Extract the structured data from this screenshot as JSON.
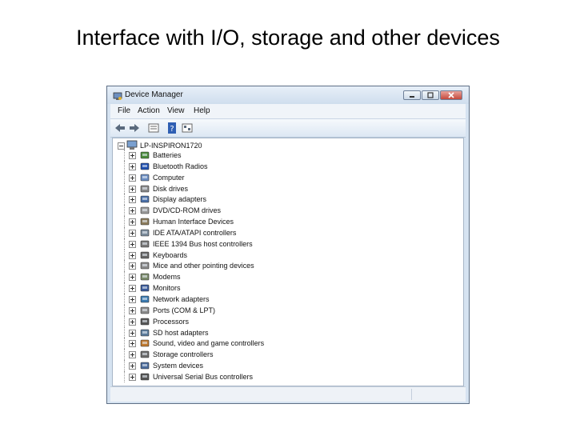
{
  "slide": {
    "title": "Interface with I/O, storage and other devices"
  },
  "window": {
    "title": "Device Manager",
    "controls": {
      "minimize": "",
      "maximize": "",
      "close": ""
    },
    "menu": [
      "File",
      "Action",
      "View",
      "Help"
    ],
    "toolbar": [
      "back-icon",
      "forward-icon",
      "properties-icon",
      "help-icon",
      "scan-icon"
    ],
    "tree": {
      "root": "LP-INSPIRON1720",
      "items": [
        {
          "label": "Batteries",
          "icon": "battery-icon"
        },
        {
          "label": "Bluetooth Radios",
          "icon": "bluetooth-icon"
        },
        {
          "label": "Computer",
          "icon": "computer-icon"
        },
        {
          "label": "Disk drives",
          "icon": "disk-drive-icon"
        },
        {
          "label": "Display adapters",
          "icon": "display-adapter-icon"
        },
        {
          "label": "DVD/CD-ROM drives",
          "icon": "dvd-drive-icon"
        },
        {
          "label": "Human Interface Devices",
          "icon": "hid-icon"
        },
        {
          "label": "IDE ATA/ATAPI controllers",
          "icon": "ide-controller-icon"
        },
        {
          "label": "IEEE 1394 Bus host controllers",
          "icon": "firewire-icon"
        },
        {
          "label": "Keyboards",
          "icon": "keyboard-icon"
        },
        {
          "label": "Mice and other pointing devices",
          "icon": "mouse-icon"
        },
        {
          "label": "Modems",
          "icon": "modem-icon"
        },
        {
          "label": "Monitors",
          "icon": "monitor-icon"
        },
        {
          "label": "Network adapters",
          "icon": "network-adapter-icon"
        },
        {
          "label": "Ports (COM & LPT)",
          "icon": "port-icon"
        },
        {
          "label": "Processors",
          "icon": "processor-icon"
        },
        {
          "label": "SD host adapters",
          "icon": "sd-adapter-icon"
        },
        {
          "label": "Sound, video and game controllers",
          "icon": "sound-icon"
        },
        {
          "label": "Storage controllers",
          "icon": "storage-controller-icon"
        },
        {
          "label": "System devices",
          "icon": "system-device-icon"
        },
        {
          "label": "Universal Serial Bus controllers",
          "icon": "usb-icon"
        }
      ]
    }
  }
}
